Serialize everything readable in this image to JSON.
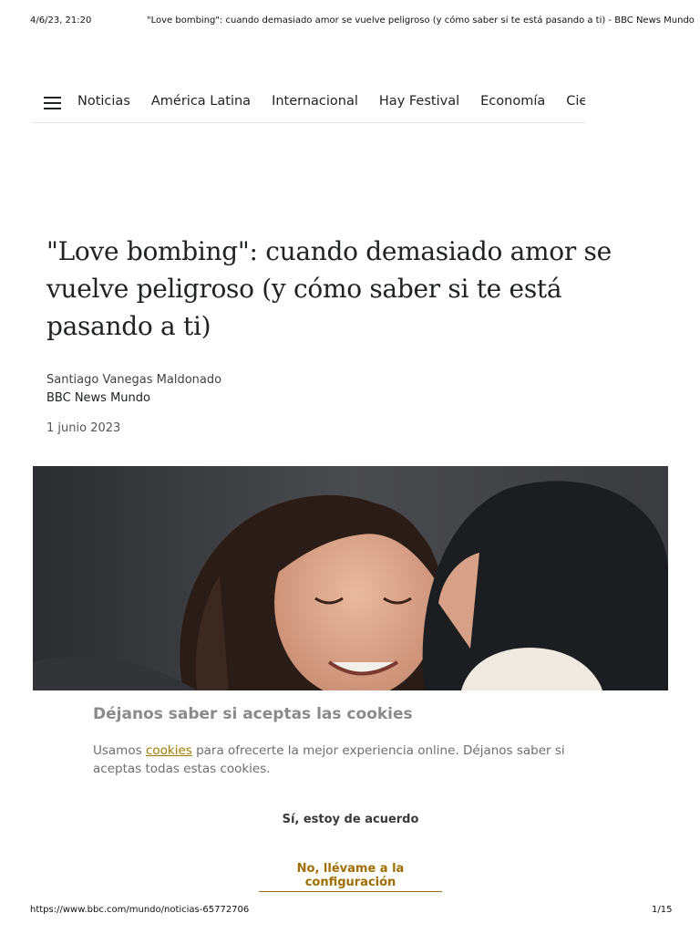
{
  "print_header": {
    "datetime": "4/6/23, 21:20",
    "title": "\"Love bombing\": cuando demasiado amor se vuelve peligroso (y cómo saber si te está pasando a ti) - BBC News Mundo"
  },
  "nav": {
    "menu_icon": "hamburger-menu-icon",
    "items": [
      "Noticias",
      "América Latina",
      "Internacional",
      "Hay Festival",
      "Economía",
      "Cie"
    ]
  },
  "article": {
    "headline": "\"Love bombing\": cuando demasiado amor se vuelve peligroso (y cómo saber si te está pasando a ti)",
    "author": "Santiago Vanegas Maldonado",
    "outlet": "BBC News Mundo",
    "date": "1 junio 2023"
  },
  "cookie_banner": {
    "title": "Déjanos saber si aceptas las cookies",
    "text_before": "Usamos ",
    "link": "cookies",
    "text_after": " para ofrecerte la mejor experiencia online. Déjanos saber si aceptas todas estas cookies.",
    "accept_label": "Sí, estoy de acuerdo",
    "settings_label": "No, llévame a la configuración"
  },
  "print_footer": {
    "url": "https://www.bbc.com/mundo/noticias-65772706",
    "page": "1/15"
  },
  "colors": {
    "text": "#202224",
    "link_gold": "#a06d00",
    "muted": "#8a8a8a"
  }
}
